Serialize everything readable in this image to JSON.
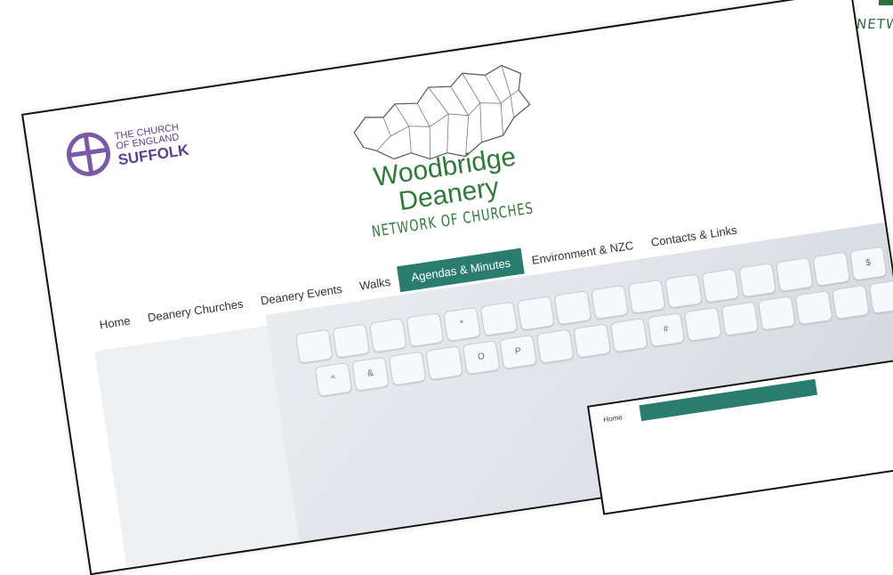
{
  "corner": {
    "text": "NETW"
  },
  "coe_logo": {
    "line1": "THE CHURCH",
    "line2": "OF ENGLAND",
    "line3": "SUFFOLK"
  },
  "site_logo": {
    "line1": "Woodbridge",
    "line2": "Deanery",
    "tagline": "NETWORK OF CHURCHES"
  },
  "nav": {
    "items": [
      {
        "label": "Home"
      },
      {
        "label": "Deanery Churches"
      },
      {
        "label": "Deanery Events"
      },
      {
        "label": "Walks"
      },
      {
        "label": "Agendas & Minutes",
        "active": true
      },
      {
        "label": "Environment & NZC"
      },
      {
        "label": "Contacts & Links"
      }
    ]
  },
  "keys": [
    "",
    "",
    "",
    "",
    "*",
    "",
    "",
    "",
    "",
    "",
    "",
    "",
    "",
    "",
    "",
    "$",
    "%",
    "^",
    "&",
    "",
    "",
    "O",
    "P",
    "",
    "",
    "",
    "#",
    "",
    "",
    "",
    "",
    "",
    "",
    ""
  ],
  "mini_card": {
    "home": "Home"
  },
  "colors": {
    "brand_green": "#2f7a3a",
    "accent_teal": "#2a7d6e",
    "coe_purple": "#5a3f8c"
  }
}
